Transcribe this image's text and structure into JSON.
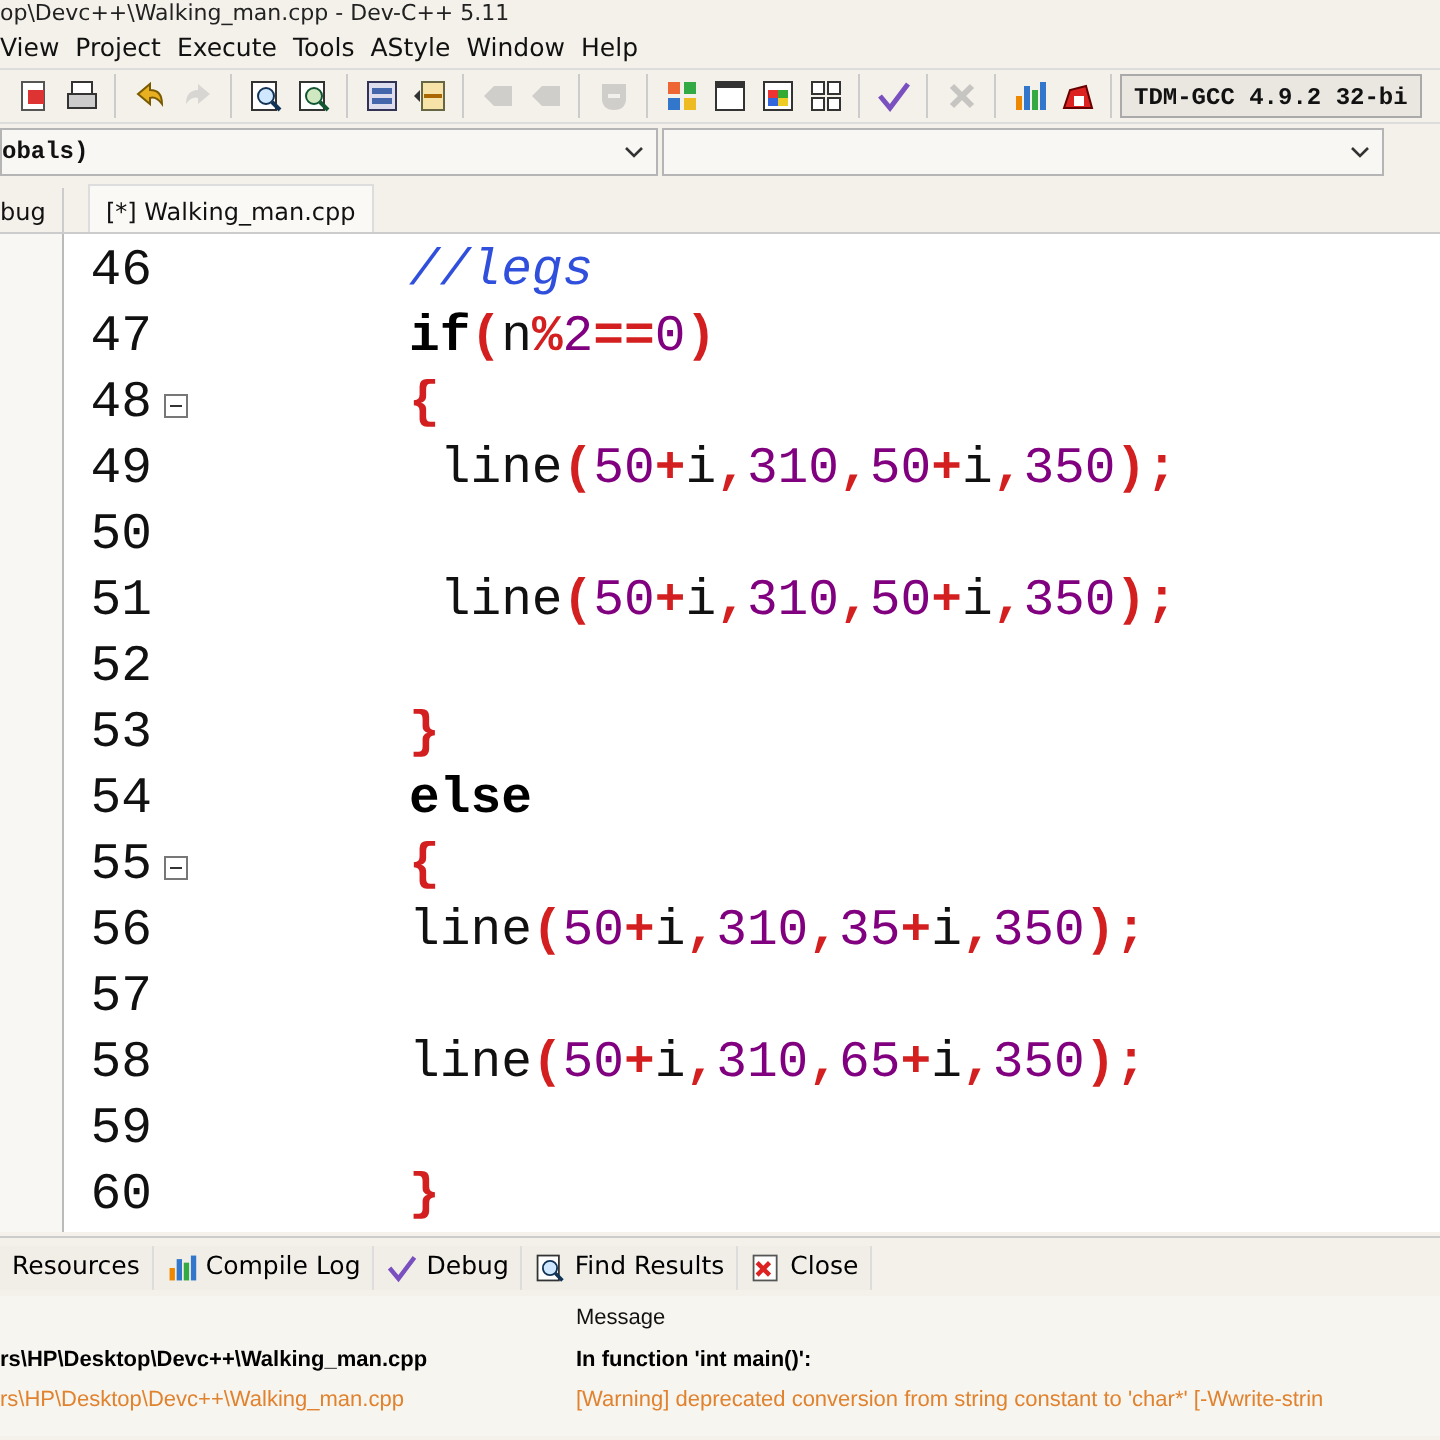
{
  "window": {
    "title": "op\\Devc++\\Walking_man.cpp - Dev-C++ 5.11"
  },
  "menu": [
    "View",
    "Project",
    "Execute",
    "Tools",
    "AStyle",
    "Window",
    "Help"
  ],
  "toolbar": {
    "groups": [
      [
        {
          "kind": "doc",
          "disabled": false
        },
        {
          "kind": "print",
          "disabled": false
        }
      ],
      [
        {
          "kind": "undo",
          "disabled": false
        },
        {
          "kind": "redo",
          "disabled": true
        }
      ],
      [
        {
          "kind": "find",
          "disabled": false
        },
        {
          "kind": "replace",
          "disabled": false
        }
      ],
      [
        {
          "kind": "indent",
          "disabled": false
        },
        {
          "kind": "unindent",
          "disabled": false
        }
      ],
      [
        {
          "kind": "back",
          "disabled": true
        },
        {
          "kind": "forward",
          "disabled": true
        }
      ],
      [
        {
          "kind": "toggle",
          "disabled": true
        }
      ],
      [
        {
          "kind": "grid",
          "disabled": false
        },
        {
          "kind": "window",
          "disabled": false
        },
        {
          "kind": "palette",
          "disabled": false
        },
        {
          "kind": "tiles",
          "disabled": false
        }
      ],
      [
        {
          "kind": "check",
          "disabled": false
        }
      ],
      [
        {
          "kind": "stop",
          "disabled": true
        }
      ],
      [
        {
          "kind": "chart",
          "disabled": false
        },
        {
          "kind": "bug",
          "disabled": false
        }
      ]
    ],
    "compiler": "TDM-GCC 4.9.2 32-bi"
  },
  "scope_combo": "obals)",
  "left_panel": {
    "tab": "bug"
  },
  "editor_tabs": [
    {
      "label": "[*] Walking_man.cpp",
      "selected": true
    }
  ],
  "code_lines": [
    {
      "number": "46",
      "fold": false,
      "comment": "       //legs"
    },
    {
      "number": "47",
      "fold": false,
      "keyword": "       if",
      "code": "(n%2==0)"
    },
    {
      "number": "48",
      "fold": true,
      "code": "       {"
    },
    {
      "number": "49",
      "fold": false,
      "code": "        line(50+i,310,50+i,350);"
    },
    {
      "number": "50",
      "fold": false
    },
    {
      "number": "51",
      "fold": false,
      "code": "        line(50+i,310,50+i,350);"
    },
    {
      "number": "52",
      "fold": false
    },
    {
      "number": "53",
      "fold": false,
      "code": "       }"
    },
    {
      "number": "54",
      "fold": false,
      "keyword": "       else"
    },
    {
      "number": "55",
      "fold": true,
      "code": "       {"
    },
    {
      "number": "56",
      "fold": false,
      "code": "       line(50+i,310,35+i,350);"
    },
    {
      "number": "57",
      "fold": false
    },
    {
      "number": "58",
      "fold": false,
      "code": "       line(50+i,310,65+i,350);"
    },
    {
      "number": "59",
      "fold": false
    },
    {
      "number": "60",
      "fold": false,
      "code": "       }"
    }
  ],
  "bottom_tabs": [
    {
      "label": "Resources",
      "kind": "resources",
      "selected": false
    },
    {
      "label": "Compile Log",
      "kind": "chart",
      "selected": false
    },
    {
      "label": "Debug",
      "kind": "check",
      "selected": false
    },
    {
      "label": "Find Results",
      "kind": "find",
      "selected": false
    },
    {
      "label": "Close",
      "kind": "close",
      "selected": false
    }
  ],
  "messages": {
    "columns": [
      "Message"
    ],
    "rows": [
      {
        "file": "rs\\HP\\Desktop\\Devc++\\Walking_man.cpp",
        "message": "In function 'int main()':",
        "kind": "heading"
      },
      {
        "file": "rs\\HP\\Desktop\\Devc++\\Walking_man.cpp",
        "message": "[Warning] deprecated conversion from string constant to 'char*' [-Wwrite-strin",
        "kind": "warning"
      }
    ]
  }
}
